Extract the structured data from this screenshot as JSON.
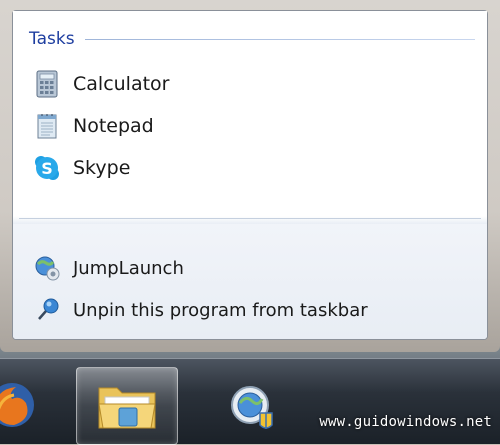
{
  "jumplist": {
    "tasks_title": "Tasks",
    "tasks": [
      {
        "label": "Calculator",
        "icon": "calculator-icon"
      },
      {
        "label": "Notepad",
        "icon": "notepad-icon"
      },
      {
        "label": "Skype",
        "icon": "skype-icon"
      }
    ],
    "pinned": [
      {
        "label": "JumpLaunch",
        "icon": "jumplaunch-icon"
      },
      {
        "label": "Unpin this program from taskbar",
        "icon": "unpin-icon"
      }
    ]
  },
  "taskbar": {
    "buttons": [
      {
        "name": "firefox",
        "icon": "firefox-icon"
      },
      {
        "name": "windows-explorer",
        "icon": "folder-icon"
      },
      {
        "name": "jumplaunch",
        "icon": "jumplaunch-icon"
      }
    ]
  },
  "watermark": "www.guidowindows.net"
}
